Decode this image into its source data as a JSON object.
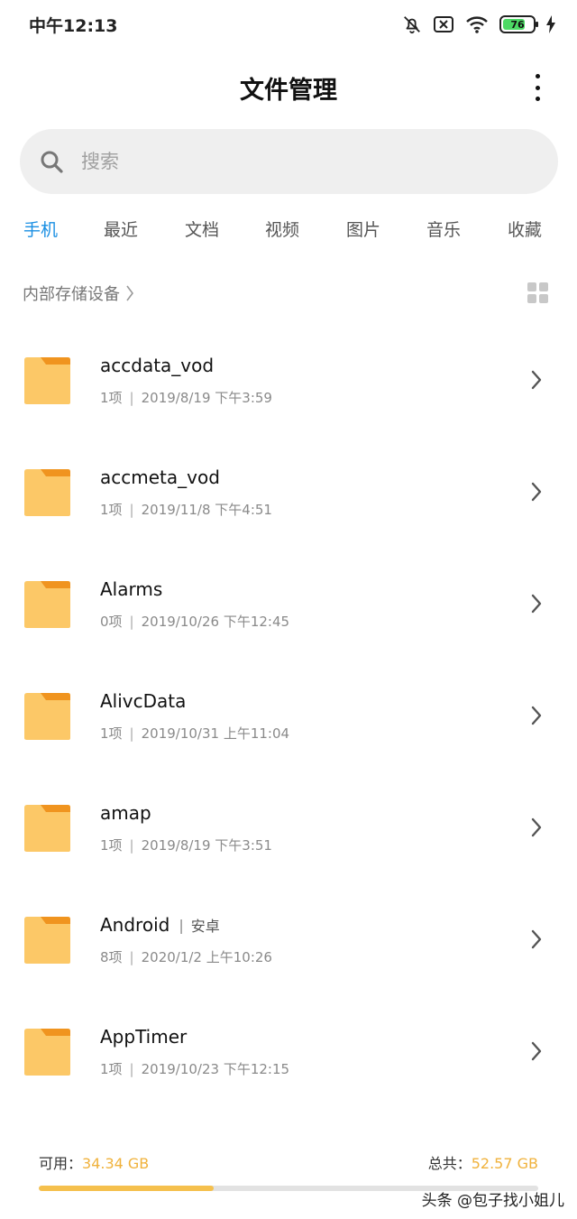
{
  "status_bar": {
    "time": "中午12:13",
    "battery_level": "76",
    "battery_fraction": 0.76,
    "icons": [
      "bell-off-icon",
      "sim-off-icon",
      "wifi-icon",
      "battery-icon",
      "charging-icon"
    ]
  },
  "header": {
    "title": "文件管理",
    "more_icon": "more-vertical-icon"
  },
  "search": {
    "placeholder": "搜索",
    "value": ""
  },
  "tabs": [
    {
      "label": "手机",
      "active": true
    },
    {
      "label": "最近",
      "active": false
    },
    {
      "label": "文档",
      "active": false
    },
    {
      "label": "视频",
      "active": false
    },
    {
      "label": "图片",
      "active": false
    },
    {
      "label": "音乐",
      "active": false
    },
    {
      "label": "收藏",
      "active": false
    }
  ],
  "breadcrumb": {
    "label": "内部存储设备"
  },
  "files": [
    {
      "name": "accdata_vod",
      "tag": "",
      "count": "1项",
      "date": "2019/8/19 下午3:59"
    },
    {
      "name": "accmeta_vod",
      "tag": "",
      "count": "1项",
      "date": "2019/11/8 下午4:51"
    },
    {
      "name": "Alarms",
      "tag": "",
      "count": "0项",
      "date": "2019/10/26 下午12:45"
    },
    {
      "name": "AlivcData",
      "tag": "",
      "count": "1项",
      "date": "2019/10/31 上午11:04"
    },
    {
      "name": "amap",
      "tag": "",
      "count": "1项",
      "date": "2019/8/19 下午3:51"
    },
    {
      "name": "Android",
      "tag": "安卓",
      "count": "8项",
      "date": "2020/1/2 上午10:26"
    },
    {
      "name": "AppTimer",
      "tag": "",
      "count": "1项",
      "date": "2019/10/23 下午12:15"
    }
  ],
  "storage": {
    "available_label": "可用：",
    "available_value": "34.34 GB",
    "total_label": "总共：",
    "total_value": "52.57 GB",
    "used_fraction": 0.35
  },
  "watermark": "头条 @包子找小姐儿",
  "colors": {
    "accent_blue": "#1a8fe3",
    "folder_yellow": "#fcc867",
    "folder_tab_orange": "#f0941f",
    "storage_orange": "#f0b23c"
  }
}
